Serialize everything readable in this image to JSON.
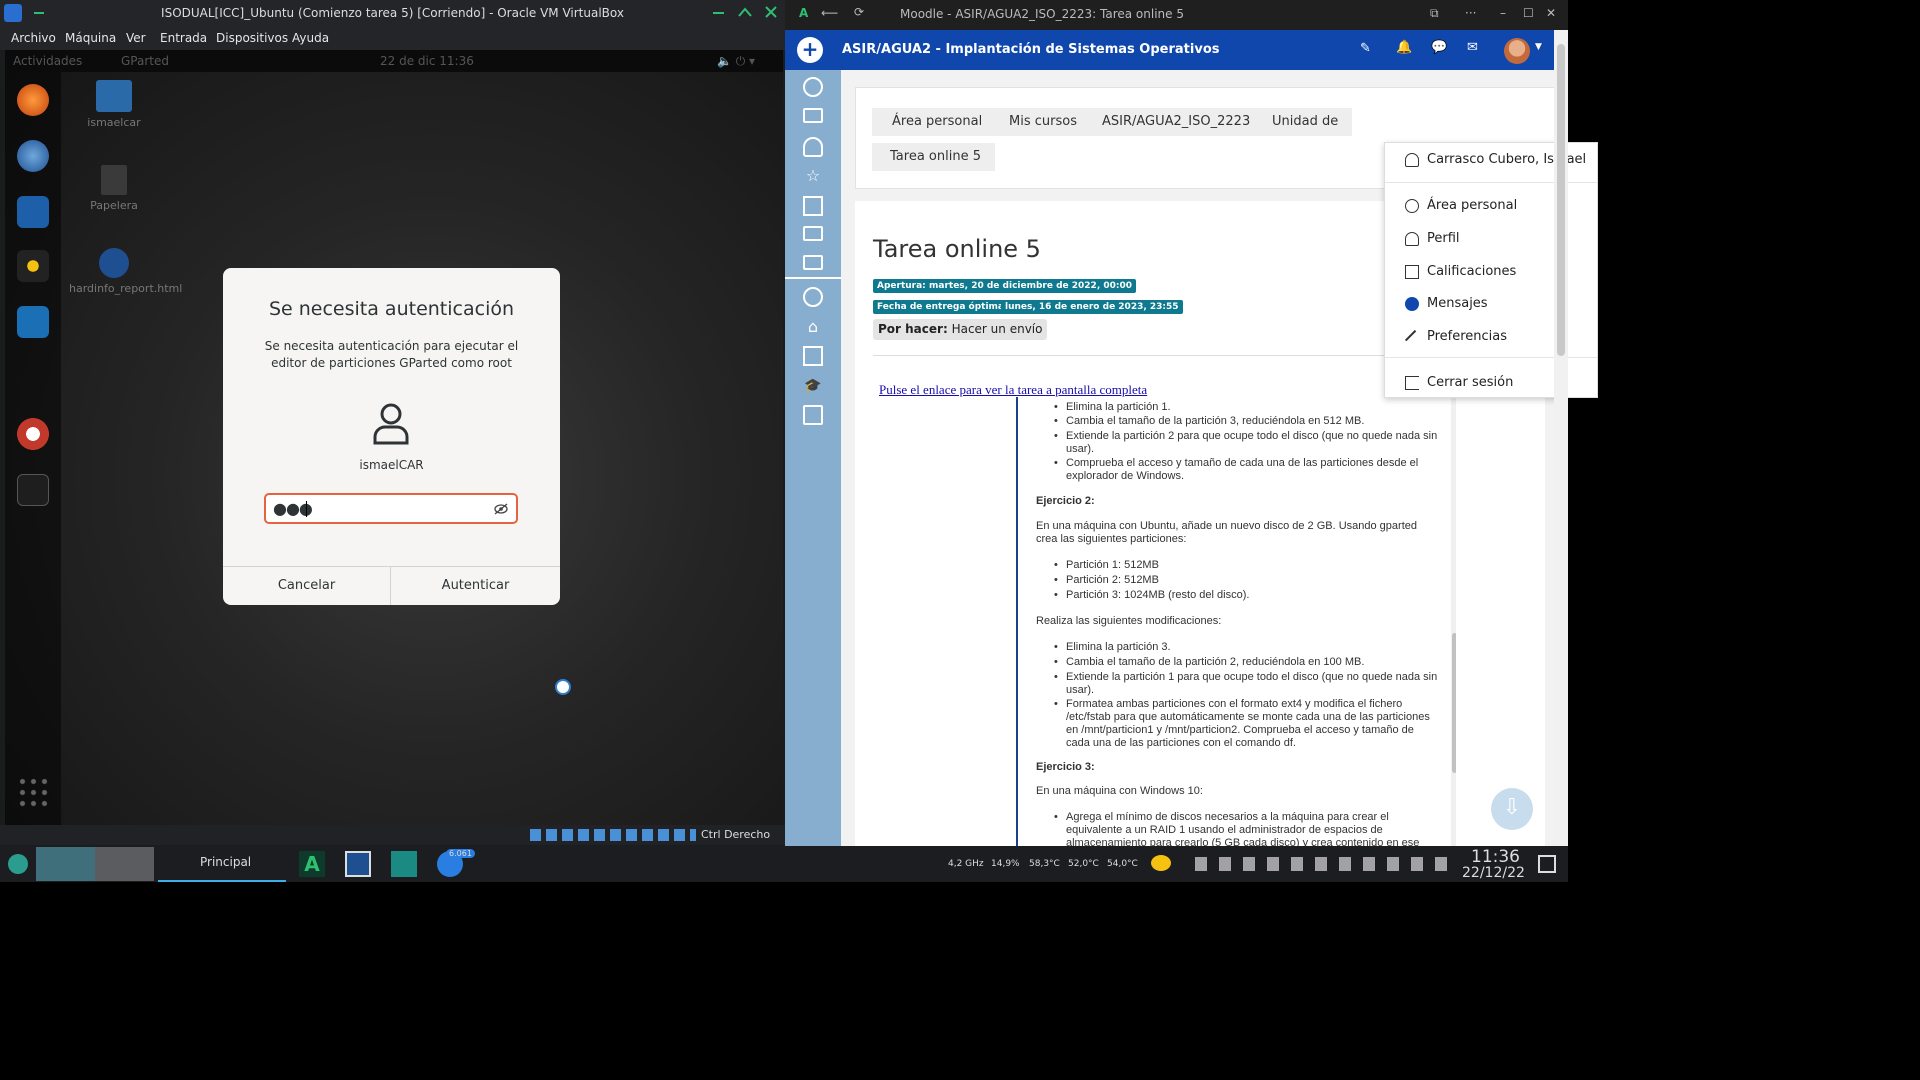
{
  "vbox": {
    "title": "ISODUAL[ICC]_Ubuntu (Comienzo tarea 5) [Corriendo] - Oracle VM VirtualBox",
    "menu": [
      "Archivo",
      "Máquina",
      "Ver",
      "Entrada",
      "Dispositivos",
      "Ayuda"
    ],
    "host_key": "Ctrl Derecho"
  },
  "guest": {
    "activities": "Actividades",
    "app": "GParted",
    "clock": "22 de dic  11:36",
    "desktop_icons": [
      "ismaelcar",
      "Papelera",
      "hardinfo_report.html"
    ]
  },
  "auth": {
    "title": "Se necesita autenticación",
    "message": "Se necesita autenticación para ejecutar el editor de particiones GParted como root",
    "username": "ismaelCAR",
    "password_mask": "●●●",
    "cancel": "Cancelar",
    "authenticate": "Autenticar"
  },
  "browser": {
    "tab_title": "Moodle - ASIR/AGUA2_ISO_2223: Tarea online 5"
  },
  "moodle": {
    "course_title": "ASIR/AGUA2 - Implantación de Sistemas Operativos",
    "breadcrumbs": [
      "Área personal",
      "Mis cursos",
      "ASIR/AGUA2_ISO_2223",
      "Unidad de",
      "Tarea online 5"
    ],
    "page_title": "Tarea online 5",
    "apertura_label": "Apertura:",
    "apertura_value": "martes, 20 de diciembre de 2022, 00:00",
    "entrega_label": "Fecha de entrega óptima:",
    "entrega_value": "lunes, 16 de enero de 2023, 23:55",
    "por_hacer_label": "Por hacer:",
    "por_hacer_value": "Hacer un envío",
    "full_link": "Pulse el enlace para ver la tarea a pantalla completa",
    "task": {
      "top_items": [
        "Elimina la partición 1.",
        "Cambia el tamaño de la partición 3, reduciéndola en 512 MB.",
        "Extiende la partición 2 para que ocupe todo el disco (que no quede nada sin usar).",
        "Comprueba el acceso y tamaño de cada una de las particiones desde el explorador de Windows."
      ],
      "ex2_heading": "Ejercicio 2:",
      "ex2_intro": "En una máquina con Ubuntu, añade un nuevo disco de 2 GB.  Usando gparted crea las siguientes particiones:",
      "ex2_parts": [
        "Partición 1: 512MB",
        "Partición 2: 512MB",
        "Partición 3: 1024MB (resto del disco)."
      ],
      "ex2_mod_intro": "Realiza las siguientes modificaciones:",
      "ex2_mods": [
        "Elimina la partición 3.",
        "Cambia el tamaño de la partición 2, reduciéndola en 100 MB.",
        "Extiende la partición 1 para que ocupe todo el disco (que no quede nada sin usar).",
        "Formatea ambas particiones con el formato ext4 y modifica el fichero /etc/fstab para que automáticamente se monte cada una de las particiones en /mnt/particion1 y /mnt/particion2. Comprueba el acceso y tamaño de cada una de las particiones con el comando df."
      ],
      "ex3_heading": "Ejercicio 3:",
      "ex3_intro": "En una máquina con Windows 10:",
      "ex3_item": "Agrega el mínimo de discos necesarios a la máquina para crear el equivalente a un RAID 1 usando el administrador de espacios de almacenamiento para crearlo (5 GB cada disco) y crea contenido en ese disco que aparecerá en el"
    },
    "user_menu": {
      "name": "Carrasco Cubero, Ismael",
      "items": [
        "Área personal",
        "Perfil",
        "Calificaciones",
        "Mensajes",
        "Preferencias"
      ],
      "logout": "Cerrar sesión"
    }
  },
  "taskbar": {
    "workspace_label": "Principal",
    "badge": "6.061",
    "cpu_freq": "4,2 GHz",
    "cpu_load": "14,9%",
    "temp1": "58,3°C",
    "temp2": "52,0°C",
    "temp3": "54,0°C",
    "time": "11:36",
    "date": "22/12/22"
  },
  "colors": {
    "moodle_blue": "#0f47ad",
    "rail": "#88aecf",
    "badge_teal": "#0f7a8f",
    "focus_orange": "#e66341"
  }
}
